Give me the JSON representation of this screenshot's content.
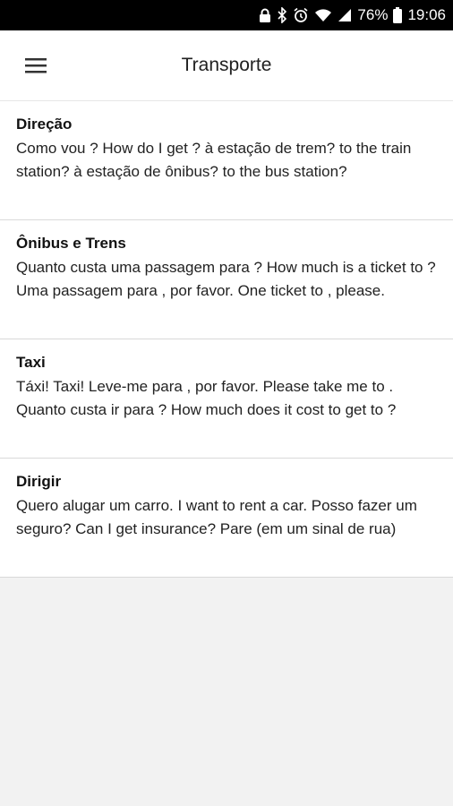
{
  "status_bar": {
    "battery": "76%",
    "time": "19:06",
    "icons": [
      "lock-icon",
      "bluetooth-icon",
      "alarm-icon",
      "wifi-icon",
      "signal-icon",
      "battery-icon"
    ]
  },
  "app_bar": {
    "title": "Transporte",
    "menu_icon": "hamburger-menu-icon"
  },
  "items": [
    {
      "title": "Direção",
      "description": "Como vou  ?  How do I get  ? à estação de trem?  to the train station? à estação de ônibus?  to the bus station?"
    },
    {
      "title": "Ônibus e Trens",
      "description": "Quanto custa uma passagem para ?  How much is a ticket to ? Uma passagem para , por favor.  One ticket to , please."
    },
    {
      "title": "Taxi",
      "description": "Táxi!  Taxi! Leve-me para , por favor.  Please take me to . Quanto custa ir para ?  How much does it cost to get to ?"
    },
    {
      "title": "Dirigir",
      "description": "Quero alugar um carro.  I want to rent a car. Posso fazer um seguro?  Can I get insurance? Pare (em um sinal de rua)"
    }
  ],
  "colors": {
    "status_bar": "#000000",
    "app_bar": "#ffffff",
    "background": "#f2f2f2",
    "divider": "#d9d9d9"
  }
}
